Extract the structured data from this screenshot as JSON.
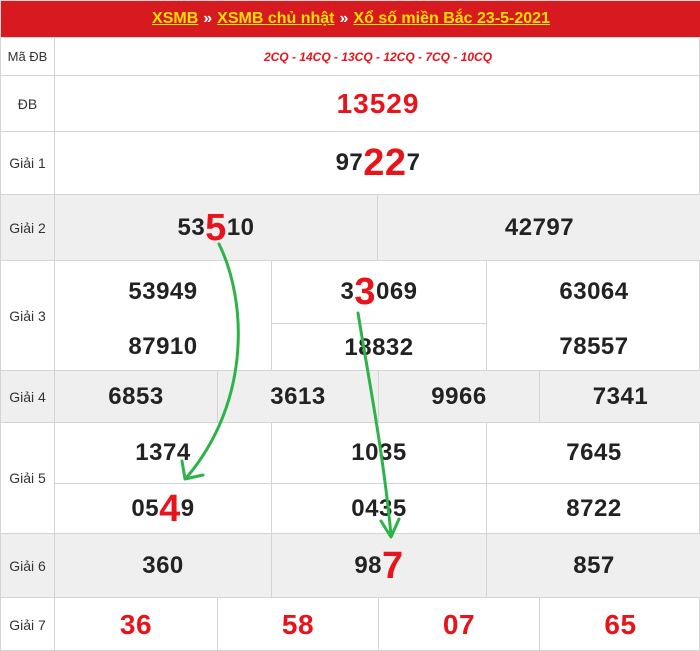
{
  "header": {
    "crumb1": "XSMB",
    "crumb2": "XSMB chủ nhật",
    "crumb3": "Xổ số miền Bắc 23-5-2021",
    "separator": "»"
  },
  "labels": {
    "ma_db": "Mã ĐB",
    "db": "ĐB",
    "g1": "Giải 1",
    "g2": "Giải 2",
    "g3": "Giải 3",
    "g4": "Giải 4",
    "g5": "Giải 5",
    "g6": "Giải 6",
    "g7": "Giải 7"
  },
  "codes": "2CQ - 14CQ - 13CQ - 12CQ - 7CQ - 10CQ",
  "db": "13529",
  "g1": {
    "pre": "97",
    "hl": "22",
    "post": "7"
  },
  "g2": [
    {
      "pre": "53",
      "hl": "5",
      "post": "10"
    },
    {
      "value": "42797"
    }
  ],
  "g3": [
    {
      "value": "53949"
    },
    {
      "pre": "3",
      "hl": "3",
      "post": "069"
    },
    {
      "value": "63064"
    },
    {
      "value": "87910"
    },
    {
      "value": "18832"
    },
    {
      "value": "78557"
    }
  ],
  "g4": [
    "6853",
    "3613",
    "9966",
    "7341"
  ],
  "g5": [
    {
      "value": "1374"
    },
    {
      "value": "1035"
    },
    {
      "value": "7645"
    },
    {
      "pre": "05",
      "hl": "4",
      "post": "9"
    },
    {
      "value": "0435"
    },
    {
      "value": "8722"
    }
  ],
  "g6": [
    {
      "value": "360"
    },
    {
      "pre": "98",
      "hl": "7",
      "post": ""
    },
    {
      "value": "857"
    }
  ],
  "g7": [
    "36",
    "58",
    "07",
    "65"
  ],
  "colors": {
    "header_bg": "#d71920",
    "header_text": "#ffe000",
    "highlight": "#e8141b",
    "arrow": "#2db34a"
  }
}
